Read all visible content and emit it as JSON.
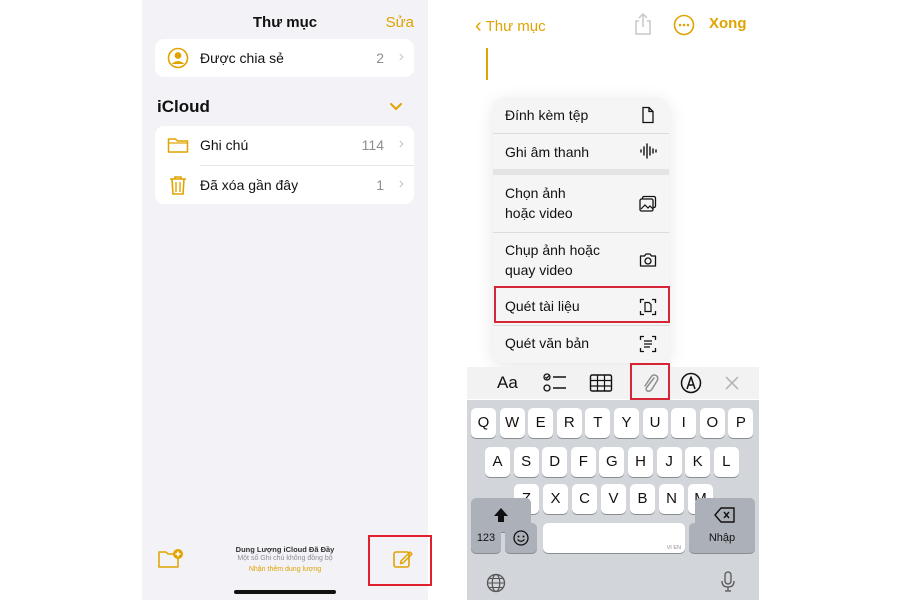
{
  "left_panel": {
    "title": "Thư mục",
    "edit_label": "Sửa",
    "shared": {
      "label": "Được chia sẻ",
      "count": "2"
    },
    "section_title": "iCloud",
    "folders": [
      {
        "label": "Ghi chú",
        "count": "114"
      },
      {
        "label": "Đã xóa gần đây",
        "count": "1"
      }
    ],
    "footer": {
      "line1": "Dung Lượng iCloud Đã Đầy",
      "line2": "Một số Ghi chú không đồng bộ",
      "link": "Nhận thêm dung lượng"
    }
  },
  "right_panel": {
    "back_label": "Thư mục",
    "done_label": "Xong",
    "attach_menu": [
      {
        "label": "Đính kèm tệp",
        "icon": "doc-icon"
      },
      {
        "label": "Ghi âm thanh",
        "icon": "waveform-icon"
      },
      {
        "label": "Chọn ảnh\nhoặc video",
        "icon": "photos-icon"
      },
      {
        "label": "Chụp ảnh hoặc\nquay video",
        "icon": "camera-icon"
      },
      {
        "label": "Quét tài liệu",
        "icon": "doc-scan-icon"
      },
      {
        "label": "Quét văn bản",
        "icon": "text-scan-icon"
      }
    ],
    "toolbar": {
      "format_label": "Aa"
    },
    "keyboard": {
      "row1": [
        "Q",
        "W",
        "E",
        "R",
        "T",
        "Y",
        "U",
        "I",
        "O",
        "P"
      ],
      "row2": [
        "A",
        "S",
        "D",
        "F",
        "G",
        "H",
        "J",
        "K",
        "L"
      ],
      "row3": [
        "Z",
        "X",
        "C",
        "V",
        "B",
        "N",
        "M"
      ],
      "numbers_label": "123",
      "space_hint": "VI EN",
      "return_label": "Nhập"
    }
  },
  "colors": {
    "accent": "#e0a300",
    "highlight": "#d62535"
  }
}
